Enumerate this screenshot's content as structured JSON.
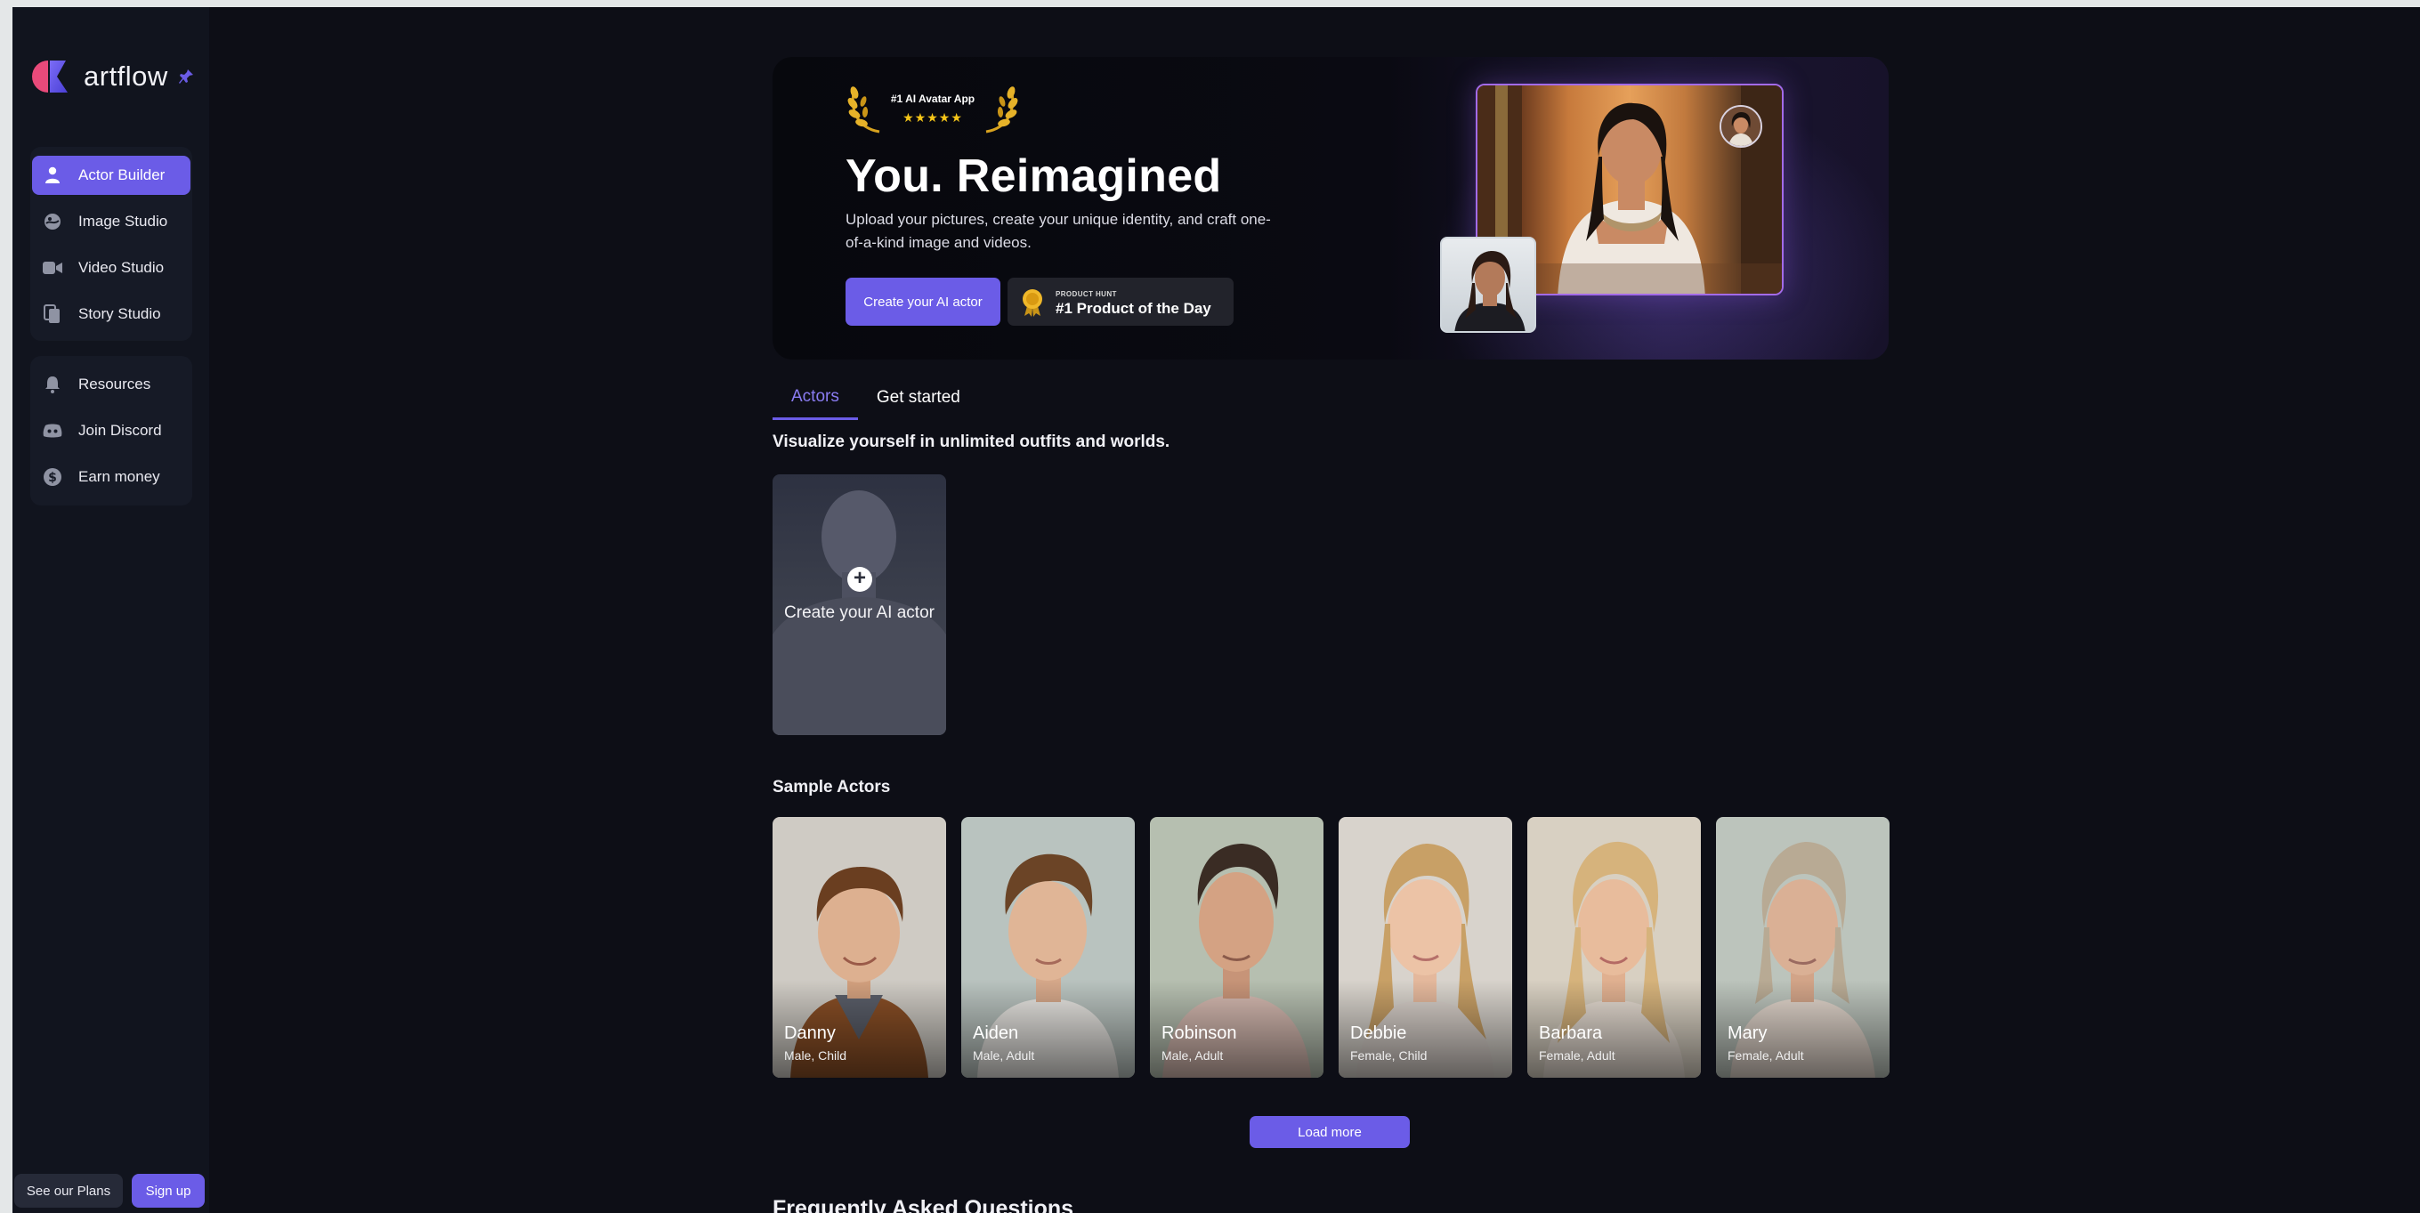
{
  "sidebar": {
    "logo_text": "artflow",
    "primary_nav": [
      {
        "label": "Actor Builder",
        "icon": "person-icon",
        "active": true
      },
      {
        "label": "Image Studio",
        "icon": "image-studio-icon",
        "active": false
      },
      {
        "label": "Video Studio",
        "icon": "video-camera-icon",
        "active": false
      },
      {
        "label": "Story Studio",
        "icon": "story-pages-icon",
        "active": false
      }
    ],
    "secondary_nav": [
      {
        "label": "Resources",
        "icon": "bell-icon"
      },
      {
        "label": "Join Discord",
        "icon": "discord-icon"
      },
      {
        "label": "Earn money",
        "icon": "dollar-coin-icon"
      }
    ],
    "see_plans_label": "See our Plans",
    "signup_label": "Sign up"
  },
  "hero": {
    "award_title": "#1 AI Avatar App",
    "award_stars": "★★★★★",
    "title": "You. Reimagined",
    "description": "Upload your pictures, create your unique identity, and craft one-of-a-kind image and videos.",
    "cta_label": "Create your AI actor",
    "product_hunt_small": "PRODUCT HUNT",
    "product_hunt_big": "#1 Product of the Day"
  },
  "tabs": [
    {
      "label": "Actors",
      "active": true
    },
    {
      "label": "Get started",
      "active": false
    }
  ],
  "visualize_heading": "Visualize yourself in unlimited outfits and worlds.",
  "create_card_label": "Create your AI actor",
  "sample_heading": "Sample Actors",
  "actors": [
    {
      "name": "Danny",
      "meta": "Male, Child"
    },
    {
      "name": "Aiden",
      "meta": "Male, Adult"
    },
    {
      "name": "Robinson",
      "meta": "Male, Adult"
    },
    {
      "name": "Debbie",
      "meta": "Female, Child"
    },
    {
      "name": "Barbara",
      "meta": "Female, Adult"
    },
    {
      "name": "Mary",
      "meta": "Female, Adult"
    }
  ],
  "load_more_label": "Load more",
  "faq_heading": "Frequently Asked Questions",
  "colors": {
    "accent": "#6b5ce7",
    "background": "#0d0e16",
    "sidebar": "#11141e",
    "gold": "#f5c518"
  }
}
